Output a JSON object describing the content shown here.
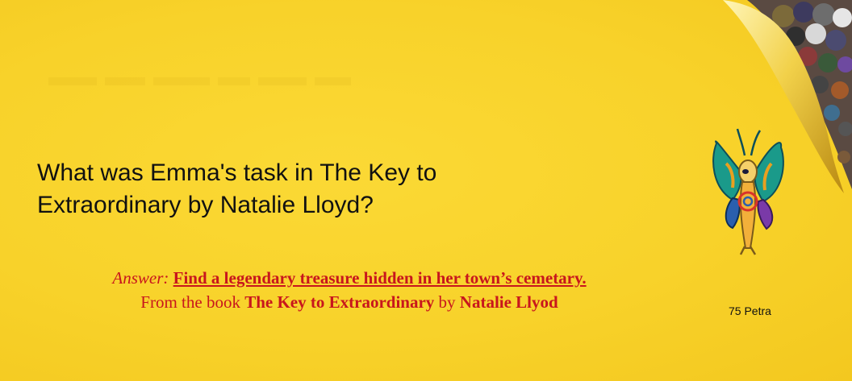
{
  "question": {
    "line1": "What was Emma's task in The Key to",
    "line2": "Extraordinary  by Natalie Lloyd?"
  },
  "answer": {
    "label": "Answer:",
    "text": "Find a legendary treasure hidden in her town’s cemetary.",
    "from_prefix": "From the book",
    "book_title": "The Key to Extraordinary",
    "by": "by",
    "author": "Natalie Llyod"
  },
  "credit": "75 Petra",
  "colors": {
    "background": "#f8d22a",
    "answer_red": "#c8161d",
    "question_text": "#111111"
  },
  "icons": {
    "page_curl": "page-curl-with-character-collage",
    "mascot": "butterfly-character-mascot"
  }
}
